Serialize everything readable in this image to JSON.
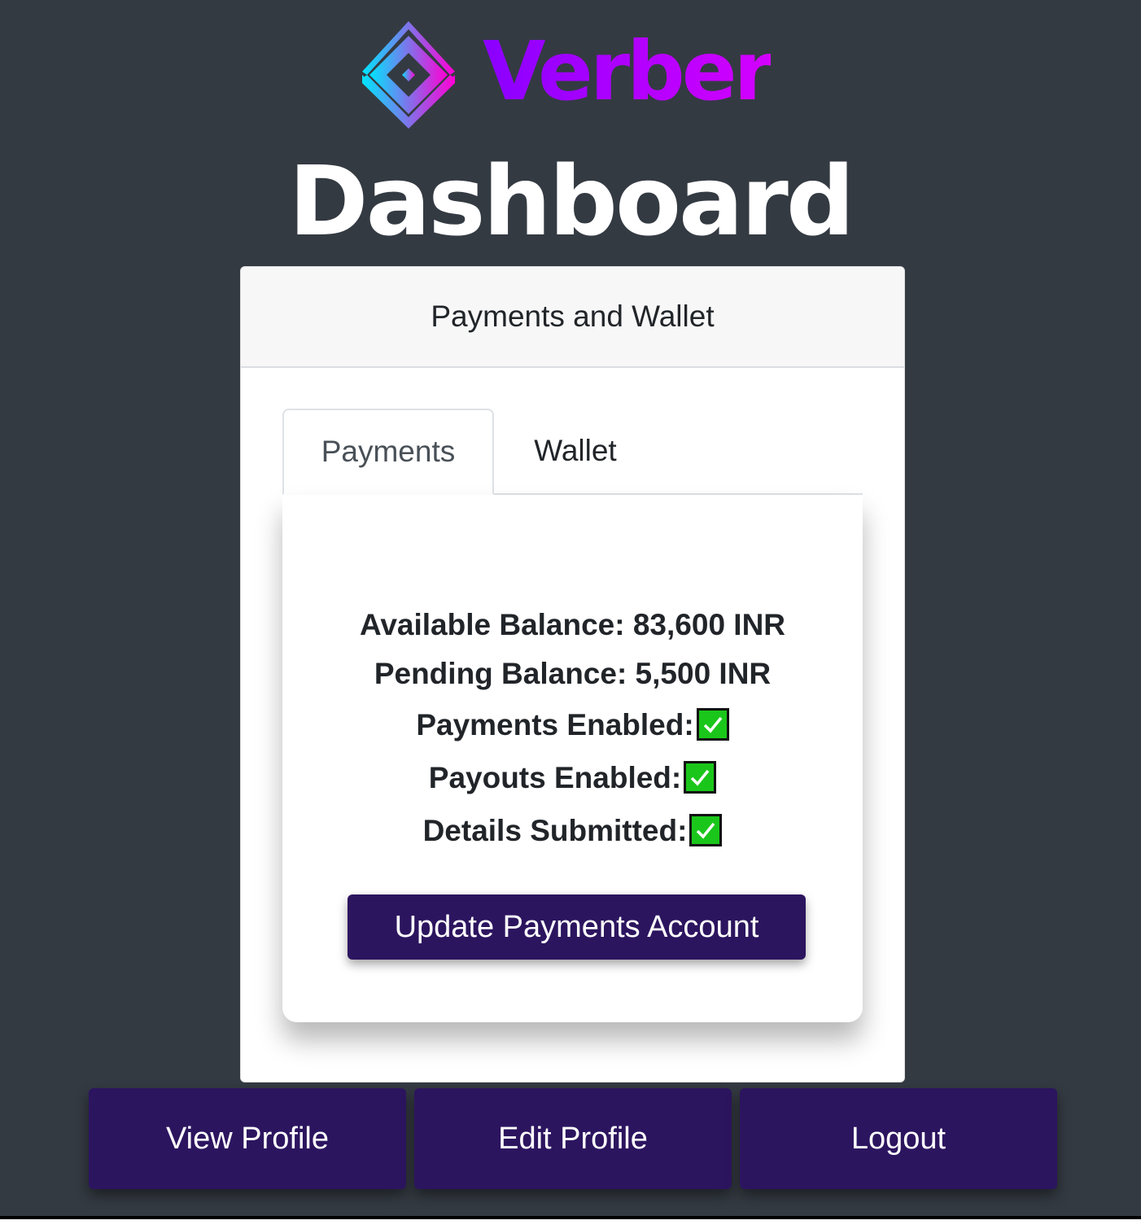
{
  "brand": {
    "name": "Verber",
    "logo_icon": "layered-diamond-logo-icon"
  },
  "page": {
    "title": "Dashboard"
  },
  "card": {
    "header": "Payments and Wallet",
    "tabs": [
      {
        "label": "Payments",
        "active": true
      },
      {
        "label": "Wallet",
        "active": false
      }
    ],
    "payments": {
      "available_balance": "Available Balance: 83,600 INR",
      "pending_balance": "Pending Balance: 5,500 INR",
      "flags": [
        {
          "label": "Payments Enabled:",
          "checked": true,
          "icon": "green-checkmark-icon"
        },
        {
          "label": "Payouts Enabled:",
          "checked": true,
          "icon": "green-checkmark-icon"
        },
        {
          "label": "Details Submitted:",
          "checked": true,
          "icon": "green-checkmark-icon"
        }
      ],
      "update_button": "Update Payments Account"
    }
  },
  "nav": {
    "view_profile": "View Profile",
    "edit_profile": "Edit Profile",
    "logout": "Logout"
  },
  "colors": {
    "background": "#343a42",
    "button": "#2c155f",
    "brand_gradient_start": "#8a00ff",
    "brand_gradient_end": "#d400ff",
    "check_green": "#1bc61b"
  }
}
